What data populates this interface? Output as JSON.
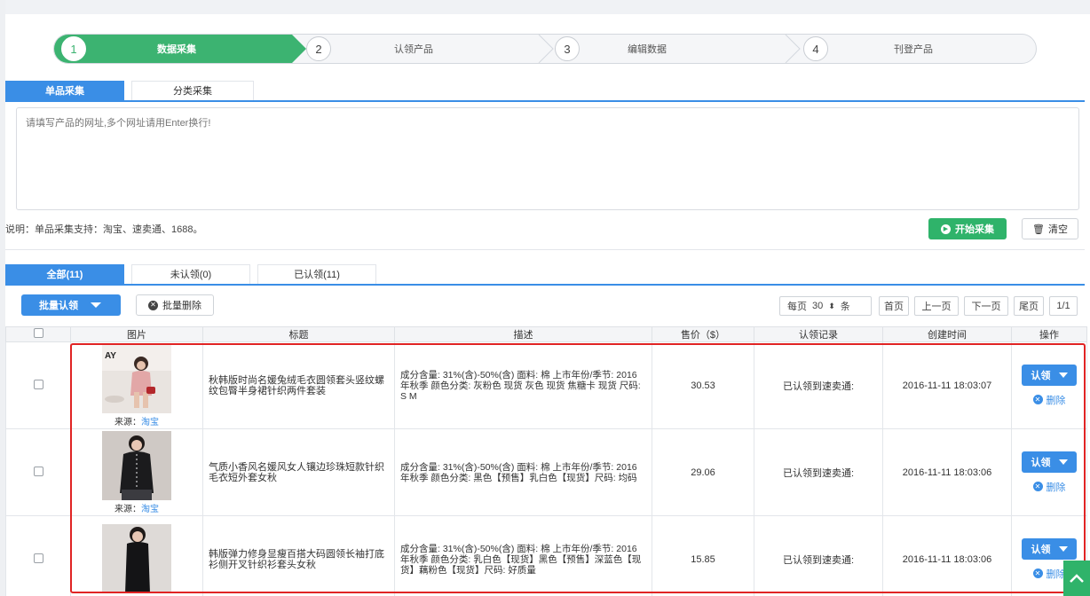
{
  "steps": [
    {
      "num": "1",
      "label": "数据采集"
    },
    {
      "num": "2",
      "label": "认领产品"
    },
    {
      "num": "3",
      "label": "编辑数据"
    },
    {
      "num": "4",
      "label": "刊登产品"
    }
  ],
  "collect_tabs": [
    "单品采集",
    "分类采集"
  ],
  "url_input": {
    "placeholder": "请填写产品的网址,多个网址请用Enter换行!"
  },
  "note": "说明：单品采集支持：淘宝、速卖通、1688。",
  "start_button": "开始采集",
  "clear_button": "清空",
  "status_tabs": [
    "全部(11)",
    "未认领(0)",
    "已认领(11)"
  ],
  "batch_claim": "批量认领",
  "batch_delete": "批量删除",
  "pager": {
    "per_page_prefix": "每页",
    "per_page": "30",
    "per_page_suffix": "条",
    "first": "首页",
    "prev": "上一页",
    "next": "下一页",
    "last": "尾页",
    "page": "1/1"
  },
  "columns": [
    "图片",
    "标题",
    "描述",
    "售价（$）",
    "认领记录",
    "创建时间",
    "操作"
  ],
  "rows": [
    {
      "source_label": "来源：",
      "source": "淘宝",
      "title": "秋韩版时尚名媛兔绒毛衣圆领套头竖纹螺纹包臀半身裙针织两件套装",
      "desc": "成分含量: 31%(含)-50%(含) 面料: 棉 上市年份/季节: 2016年秋季 颜色分类: 灰粉色 现货 灰色 现货 焦糖卡 现货 尺码: S M",
      "price": "30.53",
      "record": "已认领到速卖通:",
      "created": "2016-11-11 18:03:07",
      "claim": "认领",
      "delete": "删除"
    },
    {
      "source_label": "来源：",
      "source": "淘宝",
      "title": "气质小香风名媛风女人镶边珍珠短款针织毛衣短外套女秋",
      "desc": "成分含量: 31%(含)-50%(含) 面料: 棉 上市年份/季节: 2016年秋季 颜色分类: 黑色【预售】乳白色【现货】尺码: 均码",
      "price": "29.06",
      "record": "已认领到速卖通:",
      "created": "2016-11-11 18:03:06",
      "claim": "认领",
      "delete": "删除"
    },
    {
      "source_label": "",
      "source": "",
      "title": "韩版弹力修身显瘦百搭大码圆领长袖打底衫侧开叉针织衫套头女秋",
      "desc": "成分含量: 31%(含)-50%(含) 面料: 棉 上市年份/季节: 2016年秋季 颜色分类: 乳白色【现货】黑色【预售】深蓝色【现货】藕粉色【现货】尺码: 好质量",
      "price": "15.85",
      "record": "已认领到速卖通:",
      "created": "2016-11-11 18:03:06",
      "claim": "认领",
      "delete": "删除"
    }
  ],
  "thumb_logo": "AY",
  "colors": {
    "green": "#3cb371",
    "blue": "#3a8ee6",
    "red_box": "#e02424"
  }
}
